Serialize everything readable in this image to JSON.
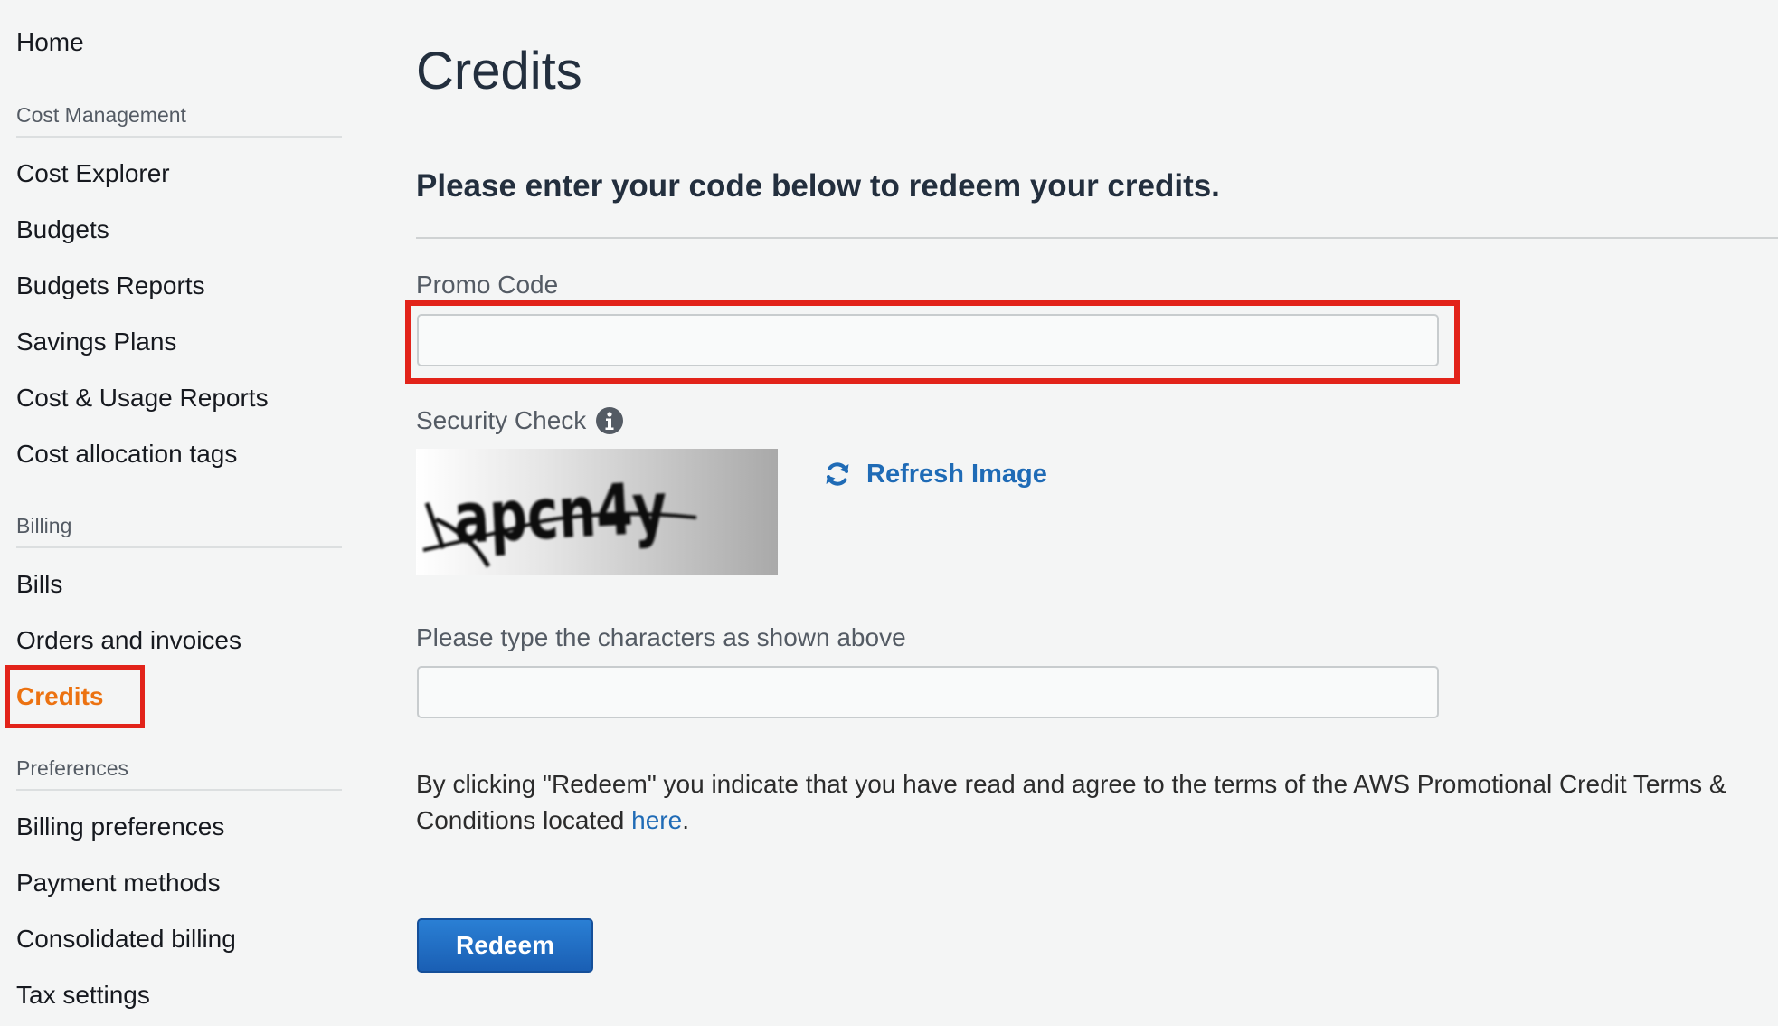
{
  "sidebar": {
    "home": "Home",
    "sections": [
      {
        "heading": "Cost Management",
        "items": [
          "Cost Explorer",
          "Budgets",
          "Budgets Reports",
          "Savings Plans",
          "Cost & Usage Reports",
          "Cost allocation tags"
        ]
      },
      {
        "heading": "Billing",
        "items": [
          "Bills",
          "Orders and invoices",
          "Credits"
        ]
      },
      {
        "heading": "Preferences",
        "items": [
          "Billing preferences",
          "Payment methods",
          "Consolidated billing",
          "Tax settings"
        ]
      }
    ],
    "active_item": "Credits"
  },
  "main": {
    "title": "Credits",
    "subheading": "Please enter your code below to redeem your credits.",
    "promo_code": {
      "label": "Promo Code",
      "value": "",
      "placeholder": ""
    },
    "security_check": {
      "label": "Security Check",
      "captcha_text": "apcn4y",
      "refresh_label": "Refresh Image"
    },
    "captcha_input": {
      "label": "Please type the characters as shown above",
      "value": "",
      "placeholder": ""
    },
    "terms": {
      "text_before": "By clicking \"Redeem\" you indicate that you have read and agree to the terms of the AWS Promotional Credit Terms & Conditions located ",
      "link_text": "here",
      "text_after": "."
    },
    "redeem_label": "Redeem"
  },
  "colors": {
    "active_nav": "#ec7211",
    "link": "#1f6bb6",
    "highlight": "#e2231a",
    "button": "#1a5fb4"
  },
  "icons": {
    "info": "info-circle-icon",
    "refresh": "refresh-icon"
  }
}
